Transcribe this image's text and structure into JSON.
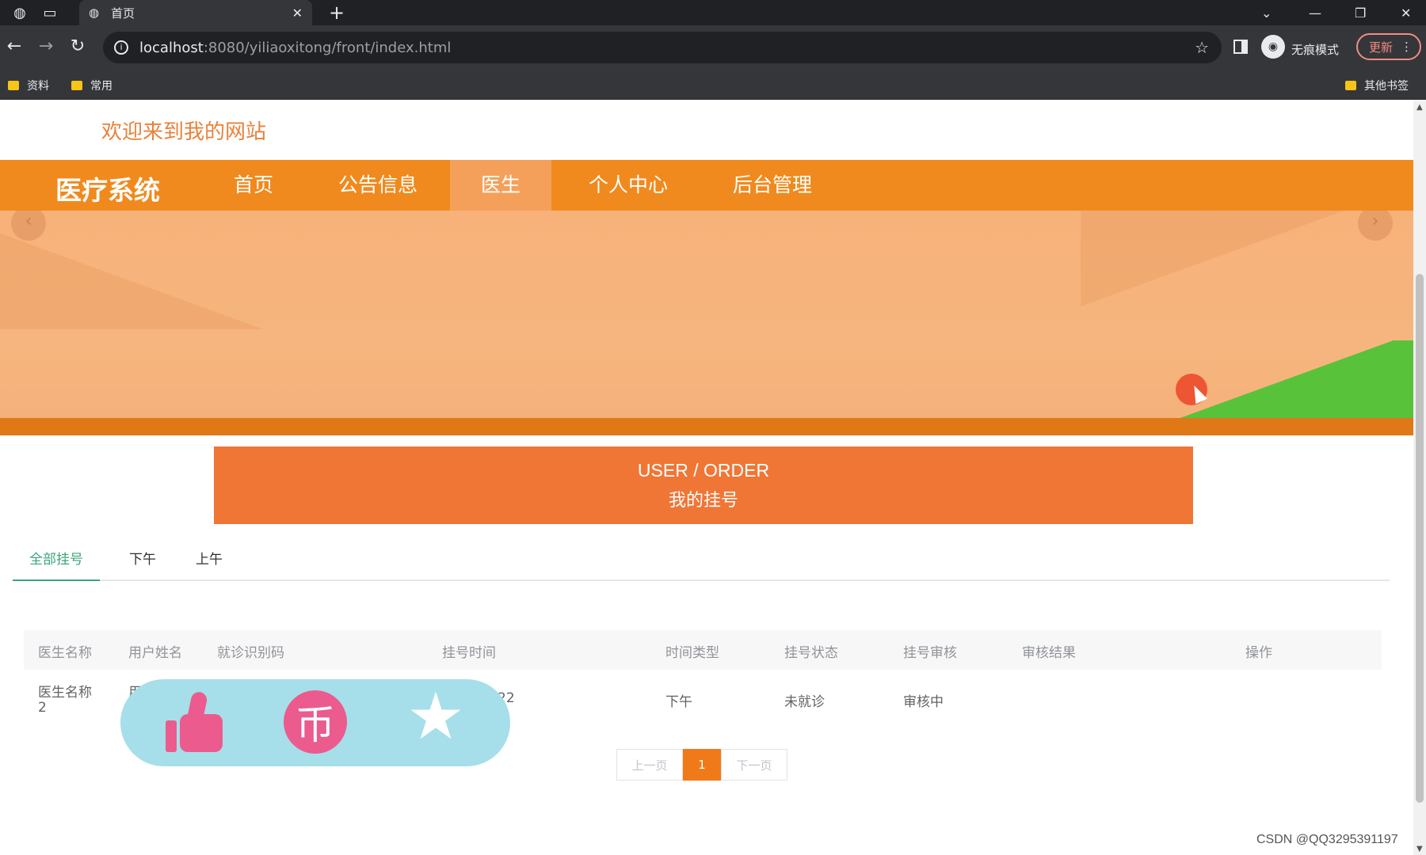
{
  "browser": {
    "tab_title": "首页",
    "url_host": "localhost",
    "url_path": ":8080/yiliaoxitong/front/index.html",
    "incognito_label": "无痕模式",
    "update_label": "更新",
    "bookmarks": [
      "资料",
      "常用"
    ],
    "other_bookmarks": "其他书签"
  },
  "site": {
    "welcome": "欢迎来到我的网站",
    "brand": "医疗系统",
    "nav": [
      "首页",
      "公告信息",
      "医生",
      "个人中心",
      "后台管理"
    ],
    "active_nav_index": 2,
    "colors": {
      "nav": "#f08a1e",
      "accent": "#f07636",
      "tab_active": "#3aa57a"
    }
  },
  "section": {
    "title_en": "USER / ORDER",
    "title_zh": "我的挂号"
  },
  "tabs": [
    {
      "label": "全部挂号",
      "active": true
    },
    {
      "label": "下午",
      "active": false
    },
    {
      "label": "上午",
      "active": false
    }
  ],
  "table": {
    "headers": [
      "医生名称",
      "用户姓名",
      "就诊识别码",
      "挂号时间",
      "时间类型",
      "挂号状态",
      "挂号审核",
      "审核结果",
      "操作"
    ],
    "rows": [
      {
        "doctor_name_line1": "医生名称",
        "doctor_name_line2": "2",
        "user_name": "用",
        "code": "",
        "time": "22",
        "time_type": "下午",
        "status": "未就诊",
        "review": "审核中",
        "result": "",
        "action": ""
      }
    ]
  },
  "overlay": {
    "icons": [
      "thumbs-up-icon",
      "coin-icon",
      "star-icon"
    ],
    "coin_glyph": "币"
  },
  "pagination": {
    "prev": "上一页",
    "current": "1",
    "next": "下一页"
  },
  "watermark": "CSDN @QQ3295391197"
}
